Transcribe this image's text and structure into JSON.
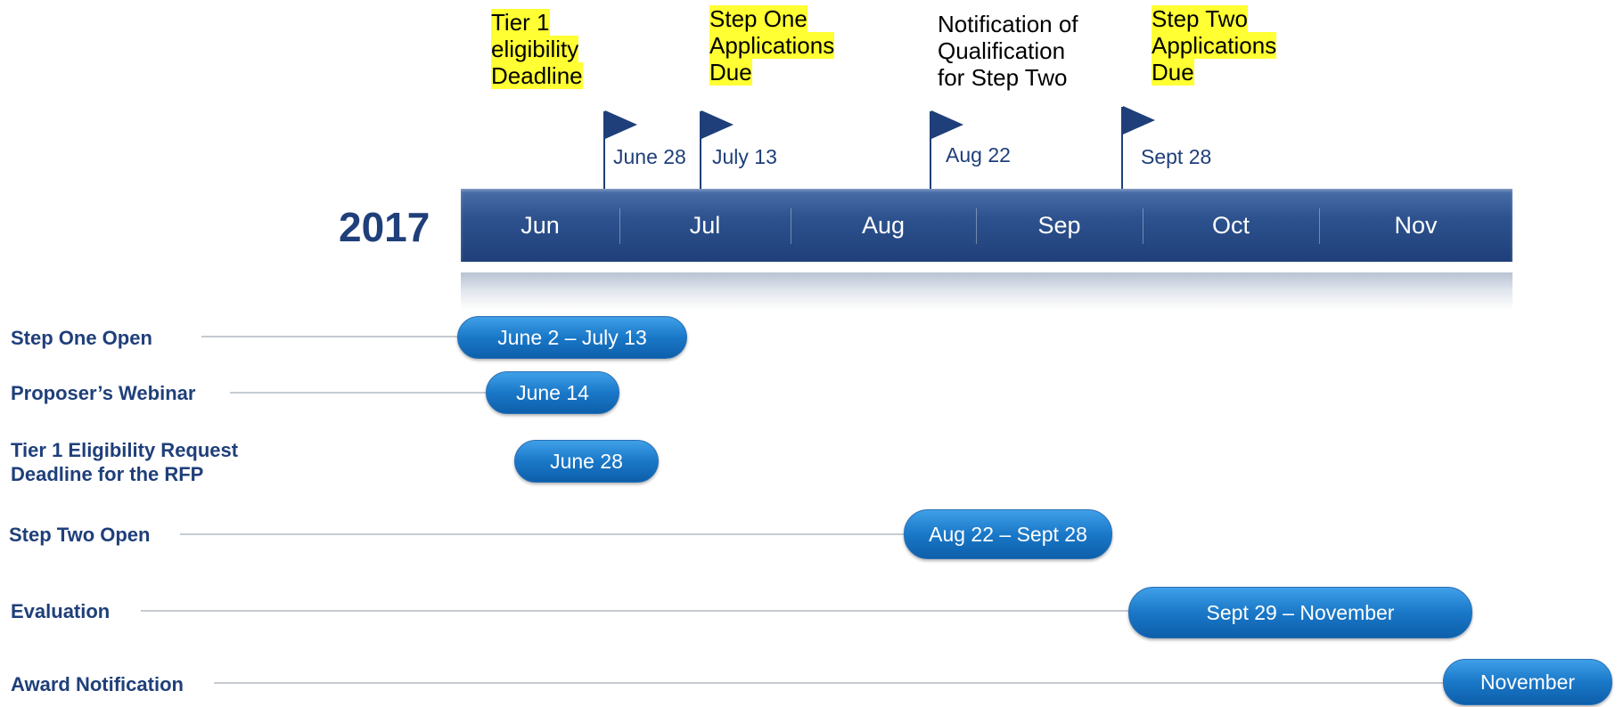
{
  "year": "2017",
  "months": [
    "Jun",
    "Jul",
    "Aug",
    "Sep",
    "Oct",
    "Nov"
  ],
  "milestones": [
    {
      "caption": "Tier 1\neligibility\nDeadline",
      "highlight": true,
      "date": "June 28"
    },
    {
      "caption": "Step One\nApplications\nDue",
      "highlight": true,
      "date": "July 13"
    },
    {
      "caption": "Notification of\nQualification\nfor Step Two",
      "highlight": false,
      "date": "Aug 22"
    },
    {
      "caption": "Step Two\nApplications\nDue",
      "highlight": true,
      "date": "Sept 28"
    }
  ],
  "rows": [
    {
      "label": "Step One Open",
      "pill": "June 2 – July 13"
    },
    {
      "label": "Proposer’s Webinar",
      "pill": "June 14"
    },
    {
      "label": "Tier 1 Eligibility Request\nDeadline for the RFP",
      "pill": "June 28"
    },
    {
      "label": "Step Two Open",
      "pill": "Aug 22 – Sept 28"
    },
    {
      "label": "Evaluation",
      "pill": "Sept 29 – November"
    },
    {
      "label": "Award Notification",
      "pill": "November"
    }
  ],
  "colors": {
    "navy": "#1f3f7a",
    "highlight": "#ffff33",
    "pill": "#1a78c8"
  }
}
